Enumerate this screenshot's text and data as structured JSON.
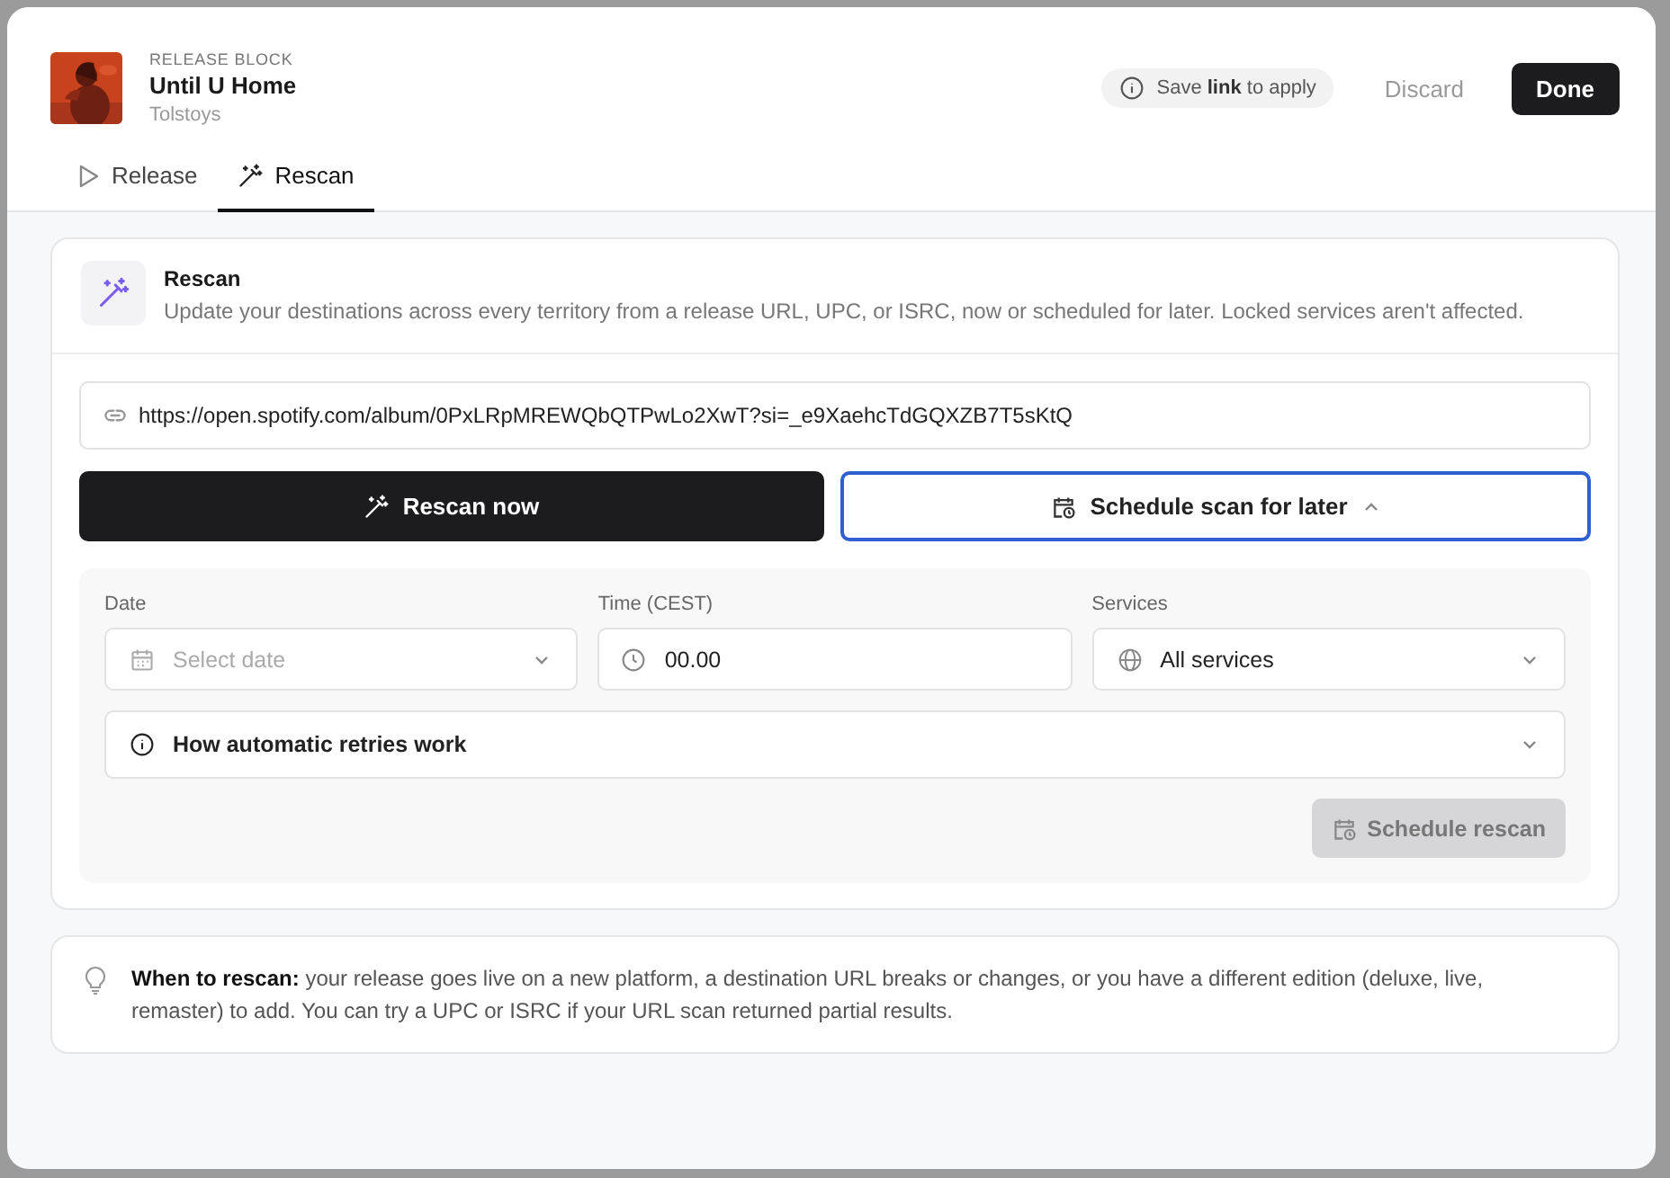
{
  "release": {
    "eyebrow": "RELEASE BLOCK",
    "title": "Until U Home",
    "artist": "Tolstoys"
  },
  "save_hint": "Save **link** to apply",
  "actions": [
    {
      "label": "Discard",
      "kind": "ghost"
    },
    {
      "label": "Done",
      "kind": "primary"
    }
  ],
  "tabs": [
    {
      "label": "Release",
      "selected": false
    },
    {
      "label": "Rescan",
      "selected": true
    }
  ],
  "rescan": {
    "title": "Rescan",
    "description": "Update your destinations across every territory from a release URL, UPC, or ISRC, now or scheduled for later. Locked services aren't affected.",
    "url": "https://open.spotify.com/album/0PxLRpMREWQbQTPwLo2XwT?si=_e9XaehcTdGQXZB7T5sKtQ",
    "rescan_button": "Rescan now",
    "schedule_toggle": {
      "label": "Schedule scan for later",
      "expanded": true
    },
    "schedule": {
      "date": {
        "label": "Date",
        "placeholder": "Select date"
      },
      "time": {
        "label": "Time (CEST)",
        "value": "00.00"
      },
      "services": {
        "label": "Services",
        "value": "All services"
      },
      "retries": {
        "label": "How automatic retries work",
        "expanded": false
      },
      "submit": {
        "label": "Schedule rescan",
        "disabled": true
      }
    }
  },
  "tip": "**When to rescan:** your release goes live on a new platform, a destination URL breaks or changes, or you have a different edition (deluxe, live, remaster) to add. You can try a UPC or ISRC if your URL scan returned partial results."
}
